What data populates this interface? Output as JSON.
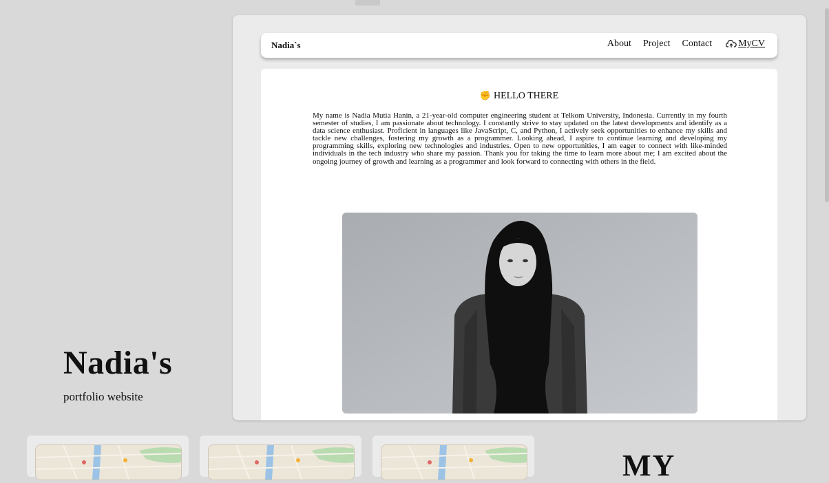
{
  "sidebar": {
    "title": "Nadia's",
    "subtitle": "portfolio website"
  },
  "navbar": {
    "brand": "Nadia`s",
    "links": [
      "About",
      "Project",
      "Contact"
    ],
    "cv_label": "MyCV"
  },
  "main": {
    "hello_icon": "✊",
    "hello": "HELLO THERE",
    "bio": "My name is Nadia Mutia Hanin, a 21-year-old computer engineering student at Telkom University, Indonesia. Currently in my fourth semester of studies, I am passionate about technology. I constantly strive to stay updated on the latest developments and identify as a data science enthusiast. Proficient in languages like JavaScript, C, and Python, I actively seek opportunities to enhance my skills and tackle new challenges, fostering my growth as a programmer. Looking ahead, I aspire to continue learning and developing my programming skills, exploring new technologies and industries. Open to new opportunities, I am eager to connect with like-minded individuals in the tech industry who share my passion. Thank you for taking the time to learn more about me; I am excited about the ongoing journey of growth and learning as a programmer and look forward to connecting with others in the field."
  },
  "projects_heading": "MY",
  "colors": {
    "background": "#d9d9d9",
    "panel": "#ebebeb",
    "card": "#ffffff"
  },
  "icons": {
    "cv": "upload-cloud-icon",
    "hello": "fist-icon"
  }
}
